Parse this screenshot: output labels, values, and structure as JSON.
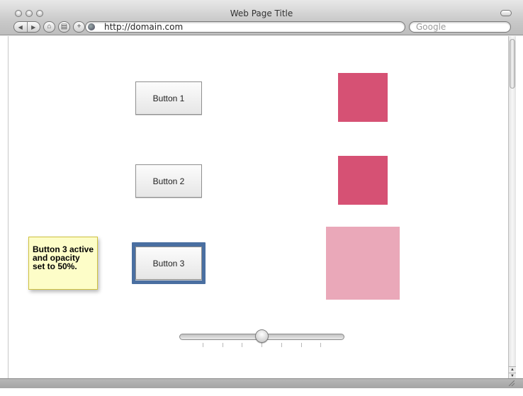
{
  "browser": {
    "window_title": "Web Page Title",
    "url": "http://domain.com",
    "search_placeholder": "Google",
    "nav": {
      "back_icon": "◀",
      "forward_icon": "▶",
      "home_icon": "⌂",
      "print_icon": "▤",
      "add_icon": "+"
    }
  },
  "main": {
    "buttons": [
      {
        "label": "Button 1"
      },
      {
        "label": "Button 2"
      },
      {
        "label": "Button 3"
      }
    ],
    "squares": [
      {
        "color": "#d65174",
        "opacity": 1
      },
      {
        "color": "#d65174",
        "opacity": 1
      },
      {
        "color": "#d65174",
        "opacity": 0.5
      }
    ],
    "note": {
      "text": "Button 3 active and opacity set to 50%."
    },
    "slider": {
      "value_fraction": 0.5,
      "tick_count": 7
    }
  },
  "colors": {
    "square": "#d65174",
    "square_faded": "#eaa8b9",
    "focus_ring": "#4a6fa1",
    "note_bg": "#fdfdc8"
  }
}
